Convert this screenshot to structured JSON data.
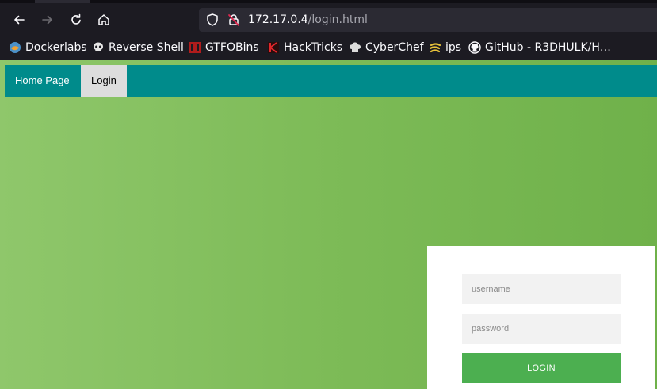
{
  "browser": {
    "url_host": "172.17.0.4",
    "url_path": "/login.html",
    "bookmarks": [
      {
        "label": "Dockerlabs",
        "icon": "dockerlabs-icon"
      },
      {
        "label": "Reverse Shell",
        "icon": "skull-icon"
      },
      {
        "label": "GTFOBins",
        "icon": "gtfobins-icon"
      },
      {
        "label": "HackTricks",
        "icon": "hacktricks-icon"
      },
      {
        "label": "CyberChef",
        "icon": "chef-hat-icon"
      },
      {
        "label": "ips",
        "icon": "ips-icon"
      },
      {
        "label": "GitHub - R3DHULK/H…",
        "icon": "github-icon"
      }
    ]
  },
  "nav": {
    "items": [
      {
        "label": "Home Page"
      },
      {
        "label": "Login",
        "active": true
      }
    ],
    "bar_color": "#008b8b"
  },
  "login": {
    "username_placeholder": "username",
    "password_placeholder": "password",
    "button_label": "LOGIN",
    "button_color": "#4caf50"
  }
}
